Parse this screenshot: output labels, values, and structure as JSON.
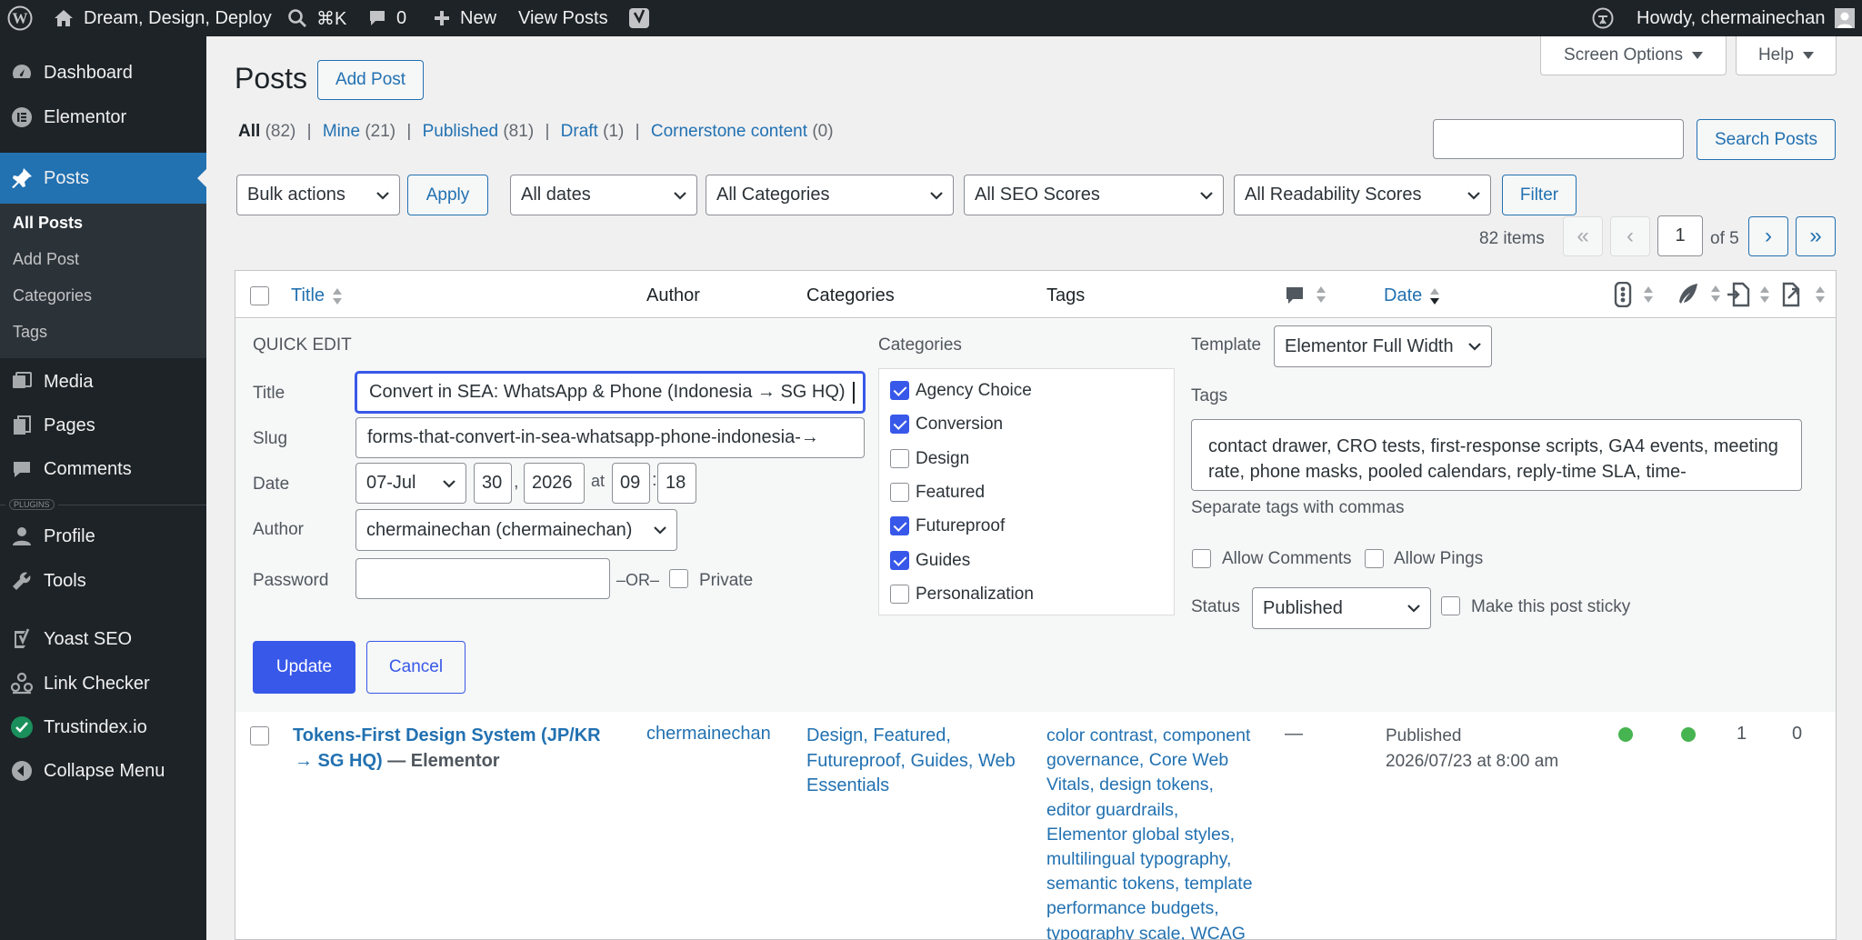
{
  "admin_bar": {
    "site_name": "Dream, Design, Deploy",
    "shortcut": "⌘K",
    "comments_count": "0",
    "new_label": "New",
    "view_posts": "View Posts",
    "howdy": "Howdy, chermainechan"
  },
  "sidebar": {
    "items": [
      {
        "label": "Dashboard",
        "icon": "dashboard-icon"
      },
      {
        "label": "Elementor",
        "icon": "elementor-icon"
      },
      {
        "label": "Posts",
        "icon": "pin-icon"
      },
      {
        "label": "Media",
        "icon": "media-icon"
      },
      {
        "label": "Pages",
        "icon": "pages-icon"
      },
      {
        "label": "Comments",
        "icon": "comments-icon"
      },
      {
        "label": "Profile",
        "icon": "user-icon"
      },
      {
        "label": "Tools",
        "icon": "wrench-icon"
      },
      {
        "label": "Yoast SEO",
        "icon": "yoast-icon"
      },
      {
        "label": "Link Checker",
        "icon": "link-checker-icon"
      },
      {
        "label": "Trustindex.io",
        "icon": "trustindex-icon"
      },
      {
        "label": "Collapse Menu",
        "icon": "collapse-icon"
      }
    ],
    "subitems": [
      "All Posts",
      "Add Post",
      "Categories",
      "Tags"
    ],
    "plugins_tag": "PLUGINS"
  },
  "top_buttons": {
    "screen_options": "Screen Options",
    "help": "Help"
  },
  "page": {
    "title": "Posts",
    "add_post": "Add Post"
  },
  "views": [
    {
      "label": "All",
      "count": "(82)"
    },
    {
      "label": "Mine",
      "count": "(21)"
    },
    {
      "label": "Published",
      "count": "(81)"
    },
    {
      "label": "Draft",
      "count": "(1)"
    },
    {
      "label": "Cornerstone content",
      "count": "(0)"
    }
  ],
  "search": {
    "value": "",
    "button": "Search Posts"
  },
  "filters": {
    "bulk_actions": "Bulk actions",
    "apply": "Apply",
    "dates": "All dates",
    "categories": "All Categories",
    "seo": "All SEO Scores",
    "readability": "All Readability Scores",
    "filter": "Filter"
  },
  "pagination": {
    "items": "82 items",
    "first": "«",
    "prev": "‹",
    "current": "1",
    "of": "of 5",
    "next": "›",
    "last": "»"
  },
  "table_head": {
    "title": "Title",
    "author": "Author",
    "categories": "Categories",
    "tags": "Tags",
    "date": "Date"
  },
  "quick_edit": {
    "heading": "QUICK EDIT",
    "title_label": "Title",
    "title_value": "Convert in SEA: WhatsApp & Phone (Indonesia → SG HQ)",
    "slug_label": "Slug",
    "slug_value": "forms-that-convert-in-sea-whatsapp-phone-indonesia-→",
    "date_label": "Date",
    "month": "07-Jul",
    "day": "30",
    "comma": ",",
    "year": "2026",
    "at": "at",
    "hour": "09",
    "colon": ":",
    "minute": "18",
    "author_label": "Author",
    "author_value": "chermainechan (chermainechan)",
    "password_label": "Password",
    "password_value": "",
    "or": "–OR–",
    "private": "Private",
    "categories_label": "Categories",
    "categories": [
      {
        "label": "Agency Choice",
        "checked": true
      },
      {
        "label": "Conversion",
        "checked": true
      },
      {
        "label": "Design",
        "checked": false
      },
      {
        "label": "Featured",
        "checked": false
      },
      {
        "label": "Futureproof",
        "checked": true
      },
      {
        "label": "Guides",
        "checked": true
      },
      {
        "label": "Personalization",
        "checked": false
      }
    ],
    "template_label": "Template",
    "template_value": "Elementor Full Width",
    "tags_label": "Tags",
    "tags_value": "contact drawer, CRO tests, first-response scripts, GA4 events, meeting rate, phone masks, pooled calendars, reply-time SLA, time-",
    "tags_hint": "Separate tags with commas",
    "allow_comments": "Allow Comments",
    "allow_pings": "Allow Pings",
    "status_label": "Status",
    "status_value": "Published",
    "sticky": "Make this post sticky",
    "update": "Update",
    "cancel": "Cancel"
  },
  "row": {
    "title_line1": "Tokens-First Design System (JP/KR",
    "title_line2": "→ SG HQ)",
    "builder": " — Elementor",
    "author": "chermainechan",
    "categories": [
      "Design,",
      "Featured,",
      "Futureproof,",
      "Guides,",
      "Web",
      "Essentials"
    ],
    "tags": [
      "color contrast,",
      "component",
      "governance,",
      "Core Web",
      "Vitals,",
      "design tokens,",
      "editor guardrails,",
      "Elementor global styles,",
      "multilingual typography,",
      "semantic tokens,",
      "template",
      "performance budgets,",
      "typography scale,",
      "WCAG"
    ],
    "comments": "—",
    "date_status": "Published",
    "date_value": "2026/07/23 at 8:00 am",
    "links_in": "1",
    "links_out": "0",
    "seo_color": "#46b450",
    "readability_color": "#46b450"
  }
}
